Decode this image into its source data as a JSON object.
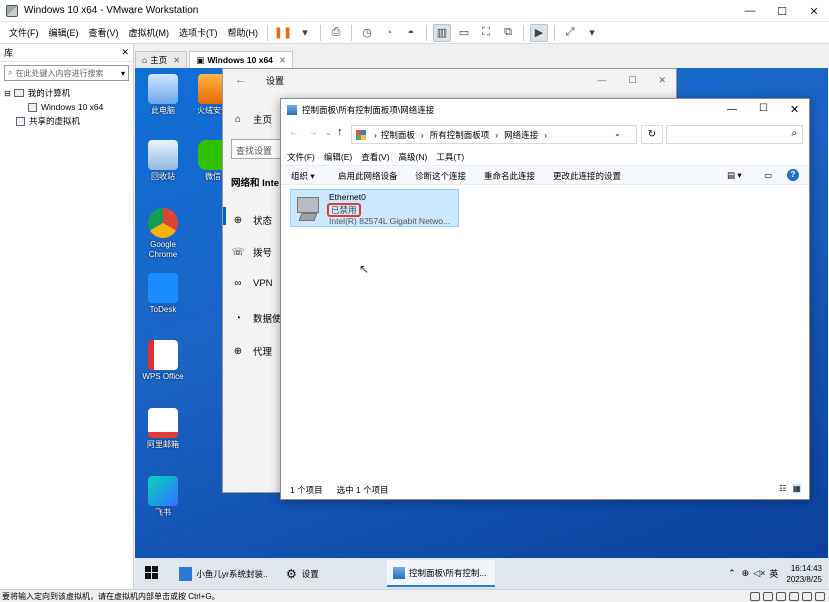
{
  "vmware": {
    "title": "Windows 10 x64 - VMware Workstation",
    "menus": [
      "文件(F)",
      "编辑(E)",
      "查看(V)",
      "虚拟机(M)",
      "选项卡(T)",
      "帮助(H)"
    ],
    "library": {
      "header": "库",
      "search_placeholder": "在此处键入内容进行搜索",
      "tree": [
        {
          "label": "我的计算机"
        },
        {
          "label": "Windows 10 x64"
        },
        {
          "label": "共享的虚拟机"
        }
      ]
    },
    "tabs": [
      {
        "label": "主页"
      },
      {
        "label": "Windows 10 x64"
      }
    ],
    "status_message": "要将输入定向到该虚拟机，请在虚拟机内部单击或按 Ctrl+G。"
  },
  "desktop": {
    "icons": [
      {
        "label": "此电脑"
      },
      {
        "label": "火绒安全"
      },
      {
        "label": "回收站"
      },
      {
        "label": "微信"
      },
      {
        "label": "Google Chrome"
      },
      {
        "label": "ToDesk"
      },
      {
        "label": "WPS Office"
      },
      {
        "label": "阿里邮箱"
      },
      {
        "label": "飞书"
      }
    ]
  },
  "settings_window": {
    "title": "设置",
    "home": "主页",
    "search_placeholder": "查找设置",
    "section": "网络和 Inte",
    "nav": [
      "状态",
      "拨号",
      "VPN",
      "数据使",
      "代理"
    ]
  },
  "network_window": {
    "title": "控制面板\\所有控制面板项\\网络连接",
    "breadcrumb": [
      "控制面板",
      "所有控制面板项",
      "网络连接"
    ],
    "menus": [
      "文件(F)",
      "编辑(E)",
      "查看(V)",
      "高级(N)",
      "工具(T)"
    ],
    "commands": [
      "组织 ▾",
      "启用此网络设备",
      "诊断这个连接",
      "重命名此连接",
      "更改此连接的设置"
    ],
    "adapter": {
      "name": "Ethernet0",
      "status": "已禁用",
      "driver": "Intel(R) 82574L Gigabit Netwo..."
    },
    "status_count": "1 个项目",
    "status_selected": "选中 1 个项目"
  },
  "taskbar": {
    "items": [
      {
        "label": "小鱼儿yr系统封装..."
      },
      {
        "label": "设置"
      },
      {
        "label": "控制面板\\所有控制..."
      }
    ],
    "ime": "英",
    "time": "16:14:43",
    "date": "2023/8/25"
  },
  "colors": {
    "accent": "#2b7bd4",
    "selection": "#cce8ff",
    "highlight_box": "#e53935",
    "pause": "#e46c0a"
  }
}
